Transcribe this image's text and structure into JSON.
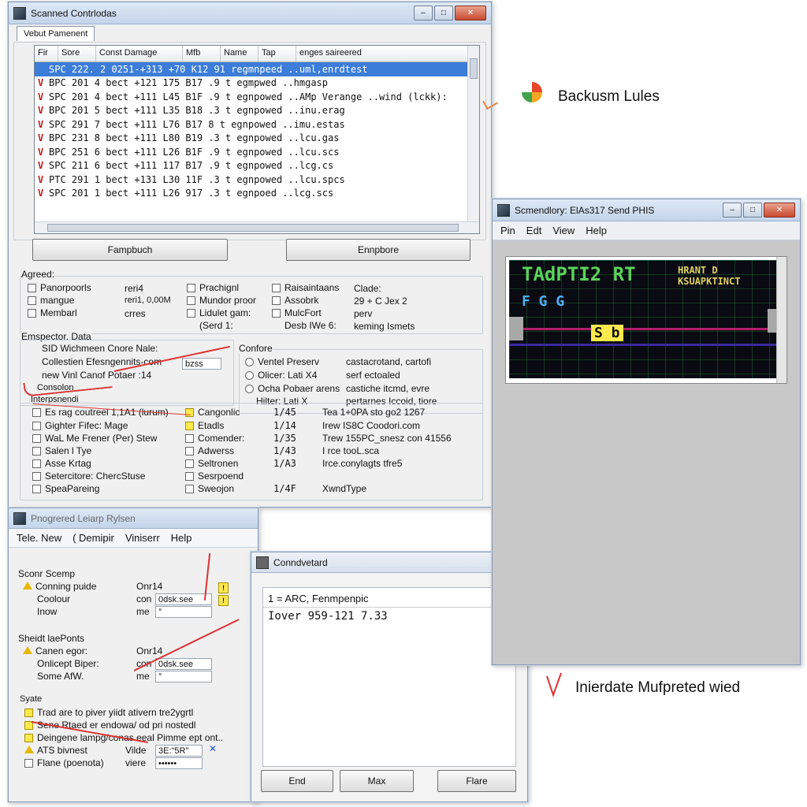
{
  "annotations": {
    "top": "Backusm Lules",
    "bottom": "Inierdate Mufpreted wied"
  },
  "main_window": {
    "title": "Scanned Contrlodas",
    "tab": "Vebut Pamenent",
    "columns": [
      "Fir",
      "Sore",
      "Const Damage",
      "Mfb",
      "Name",
      "Tap",
      "enges saireered"
    ],
    "rows": [
      {
        "mark": "",
        "text": "SPC 222. 2 0251-+313 +70 K12  91 regmnpeed ..uml,enrdtest"
      },
      {
        "mark": "V",
        "text": "BPC 201 4 bect +121 175 B17  .9 t egmpwed  ..hmgasp"
      },
      {
        "mark": "V",
        "text": "SPC 201 4 bect +111 L45 B1F  .9 t egnpowed  ..AMp Verange ..wind (lckk):"
      },
      {
        "mark": "V",
        "text": "BPC 201 5 bect +111 L35 B18  .3 t egnpowed  ..inu.erag"
      },
      {
        "mark": "V",
        "text": "SPC 291 7 bect +111 L76 B17  8 t egnpowed  ..imu.estas"
      },
      {
        "mark": "V",
        "text": "BPC 231 8 bect +111 L80 B19  .3 t egnpowed  ..lcu.gas"
      },
      {
        "mark": "V",
        "text": "BPC 251 6 bect +111 L26 B1F  .9 t egnpowed  ..lcu.scs"
      },
      {
        "mark": "V",
        "text": "SPC 211 6 bect +111 117 B17  .9 t egnpowed  ..lcg.cs"
      },
      {
        "mark": "V",
        "text": "PTC 291 1 bect +131 L30 11F  .3 t egnpowed  ..lcu.spcs"
      },
      {
        "mark": "V",
        "text": "SPC 201 1 bect +111 L26 917  .3 t egnpoed   ..lcg.scs"
      }
    ],
    "buttons": {
      "left": "Fampbuch",
      "right": "Ennpbore"
    },
    "agreed": {
      "label": "Agreed:",
      "col1": [
        "Panorpoorls",
        "mangue",
        "Membarl"
      ],
      "col2": [
        "reri4",
        "reri1, 0,00M",
        "crres"
      ],
      "col3": [
        "Prachignl",
        "Mundor proor",
        "Lidulet gam:",
        "(Serd 1:"
      ],
      "col4": [
        "Raisaintaans",
        "Assobrk",
        "MulcFort",
        "Desb IWe 6:"
      ],
      "col5": [
        "Clade:",
        "29 + C Jex 2",
        "perv",
        "keming Ismets"
      ]
    },
    "emphasis": {
      "label": "Emspector. Data",
      "lines": [
        "SID Wichmeen Cnore Nale:",
        "Collestien Efesngennits-com",
        "new Vinl Canof Potaer :14"
      ],
      "field": "bzss",
      "sub1": "Consolon",
      "sub2": "Interpsnendi"
    },
    "confare": {
      "label": "Confore",
      "items": [
        {
          "label": "Ventel Preserv",
          "value": "castacrotand, cartofi"
        },
        {
          "label": "Olicer: Lati X4",
          "value": "serf ectoaled"
        },
        {
          "label": "Ocha Pobaer  arens",
          "value": "castiche itcmd, evre"
        },
        {
          "label": "Hilter: Lati X",
          "value": "pertarnes Iccoid, tiore"
        }
      ]
    },
    "bottom_table": [
      {
        "a": "Es rag coutreel 1,1A1 (lurum)",
        "b": "Cangonlic",
        "c": "1/45",
        "d": "Tea 1+0PA sto go2 1267"
      },
      {
        "a": "Gighter Fifec: Mage",
        "b": "Etadls",
        "c": "1/14",
        "d": "Irew IS8C Coodori.com"
      },
      {
        "a": "WaL Me Frener  (Per) Stew",
        "b": "Comender:",
        "c": "1/35",
        "d": "Trew 155PC_snesz con 41556"
      },
      {
        "a": "Salen l Tye",
        "b": "Adwerss",
        "c": "1/43",
        "d": "I  rce tooL.sca"
      },
      {
        "a": "Asse Krtag",
        "b": "Seltronen",
        "c": "1/A3",
        "d": "Irce.conylagts tfre5"
      },
      {
        "a": "Setercitore: ChercStuse",
        "b": "Sesrpoend",
        "c": "",
        "d": ""
      },
      {
        "a": "SpeaPareing",
        "b": "Sweojon",
        "c": "1/4F",
        "d": "XwndType"
      }
    ]
  },
  "second_window": {
    "title": "Pnogrered Leiarp Rylsen",
    "menu": [
      "Tele. New",
      "( Demipir",
      "Viniserr",
      "Help"
    ],
    "s1": {
      "label": "Sconr Scemp",
      "rows": [
        {
          "label": "Conning puide",
          "v1": "Onr14",
          "v2": ""
        },
        {
          "label": "Coolour",
          "v1": "con",
          "v2": "0dsk.see"
        },
        {
          "label": "Inow",
          "v1": "me",
          "v2": "°"
        }
      ]
    },
    "s2": {
      "label": "Sheidt laePonts",
      "rows": [
        {
          "label": "Canen egor:",
          "v1": "Onr14",
          "v2": ""
        },
        {
          "label": "Onlicept Biper:",
          "v1": "con",
          "v2": "0dsk.see"
        },
        {
          "label": "Some AfW.",
          "v1": "me",
          "v2": "°"
        }
      ]
    },
    "s3": {
      "label": "Syate",
      "rows": [
        {
          "label": "Trad are to piver yiidt  ativern tre2ygrtl"
        },
        {
          "label": "Sene Rtaed er endowa/ od pri nostedl"
        },
        {
          "label": "Deingene lampg/conas eeal Pimme ept ont.."
        },
        {
          "label": "ATS bivnest"
        },
        {
          "label": "Flane (poenota)"
        }
      ],
      "vide": "Vilde",
      "vide_val": "3E:\"5R\"",
      "viere": "viere",
      "viere_val": "••••••"
    }
  },
  "cmd_window": {
    "title": "Conndvetard",
    "line1": "1 = ARC, Fenmpenpic",
    "line2": "Iover 959-121 7.33",
    "buttons": [
      "End",
      "Max",
      "Flare"
    ]
  },
  "viewer_window": {
    "title": "Scmendlory: ElAs317 Send PHIS",
    "menu": [
      "Pin",
      "Edt",
      "View",
      "Help"
    ],
    "screen_big": "TAdPTI2  RT",
    "screen_small1": "HRANT  D",
    "screen_small2": "KSUAPKTINCT",
    "screen_mid": "F  G  G",
    "screen_badge": "S b"
  }
}
